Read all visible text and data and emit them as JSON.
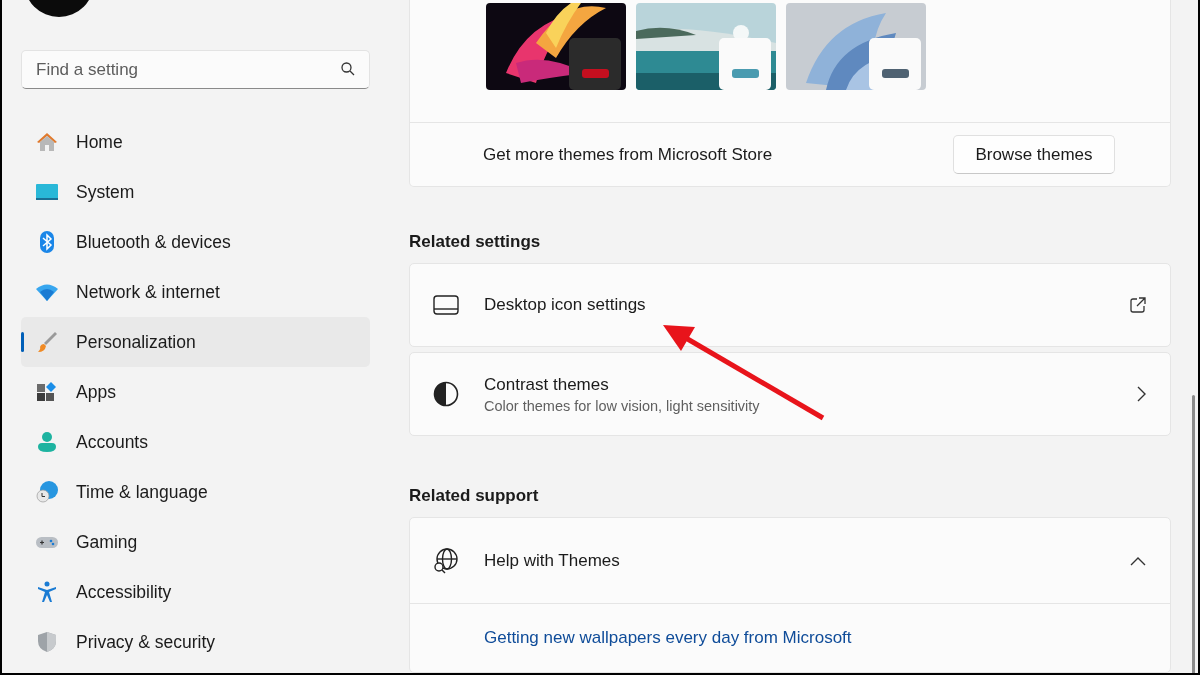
{
  "sidebar": {
    "search": {
      "placeholder": "Find a setting"
    },
    "items": [
      {
        "label": "Home",
        "selected": false
      },
      {
        "label": "System",
        "selected": false
      },
      {
        "label": "Bluetooth & devices",
        "selected": false
      },
      {
        "label": "Network & internet",
        "selected": false
      },
      {
        "label": "Personalization",
        "selected": true
      },
      {
        "label": "Apps",
        "selected": false
      },
      {
        "label": "Accounts",
        "selected": false
      },
      {
        "label": "Time & language",
        "selected": false
      },
      {
        "label": "Gaming",
        "selected": false
      },
      {
        "label": "Accessibility",
        "selected": false
      },
      {
        "label": "Privacy & security",
        "selected": false
      }
    ]
  },
  "themes": {
    "items": [
      {
        "kind": "picture",
        "dark": true,
        "color": "#c50f1f"
      },
      {
        "kind": "picture",
        "dark": false,
        "color": "#4a9bb0"
      },
      {
        "kind": "picture",
        "dark": false,
        "color": "#4f6272"
      }
    ],
    "store_text": "Get more themes from Microsoft Store",
    "button": "Browse themes"
  },
  "related_settings": {
    "title": "Related settings",
    "items": [
      {
        "kind": "external",
        "title": "Desktop icon settings"
      },
      {
        "kind": "chevron",
        "title": "Contrast themes",
        "subtitle": "Color themes for low vision, light sensitivity"
      }
    ]
  },
  "related_support": {
    "title": "Related support",
    "items": [
      {
        "title": "Help with Themes",
        "expanded": true,
        "links": [
          "Getting new wallpapers every day from Microsoft"
        ]
      }
    ]
  }
}
